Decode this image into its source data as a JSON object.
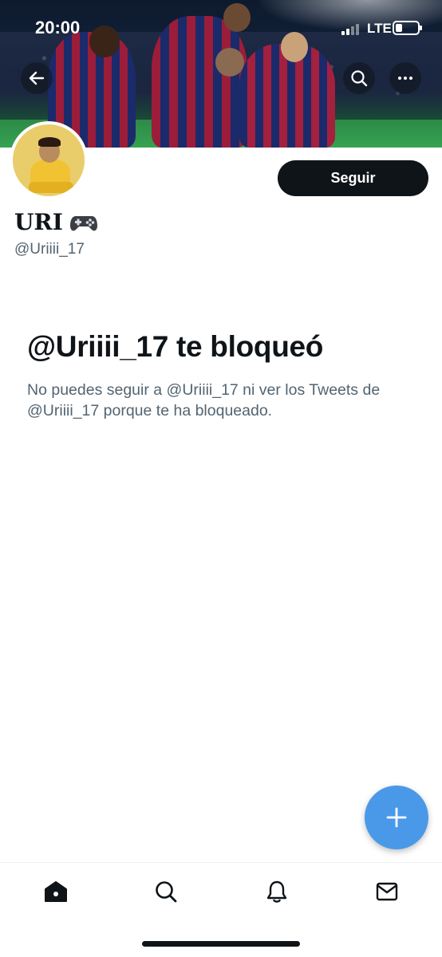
{
  "status_bar": {
    "time": "20:00",
    "network": "LTE",
    "battery_level": 0.3
  },
  "header": {
    "back_icon": "arrow-left-icon",
    "search_icon": "search-icon",
    "more_icon": "more-horizontal-icon"
  },
  "profile": {
    "display_name": "URI",
    "name_emoji": "gamepad-icon",
    "handle": "@Uriiii_17",
    "follow_label": "Seguir"
  },
  "blocked": {
    "title": "@Uriiii_17 te bloqueó",
    "description": "No puedes seguir a @Uriiii_17 ni ver los Tweets de @Uriiii_17 porque te ha bloqueado."
  },
  "fab": {
    "icon": "plus-icon",
    "color": "#4a99e9"
  },
  "bottom_nav": {
    "items": [
      {
        "icon": "home-icon",
        "active": true
      },
      {
        "icon": "search-icon",
        "active": false
      },
      {
        "icon": "bell-icon",
        "active": false
      },
      {
        "icon": "mail-icon",
        "active": false
      }
    ]
  },
  "colors": {
    "text_primary": "#0f1419",
    "text_secondary": "#536471",
    "accent": "#4a99e9"
  }
}
